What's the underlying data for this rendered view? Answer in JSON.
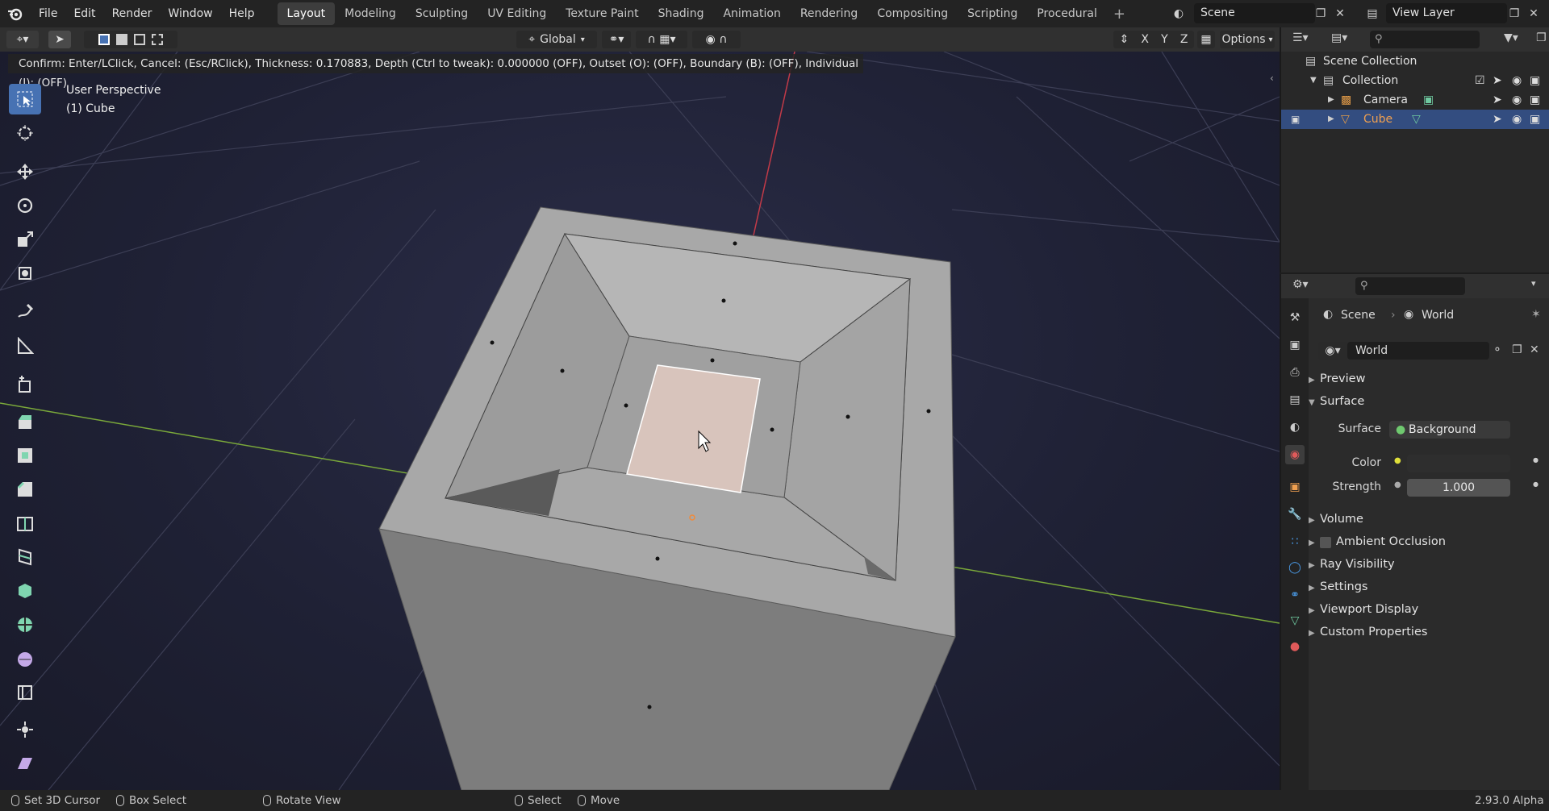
{
  "menu": [
    "File",
    "Edit",
    "Render",
    "Window",
    "Help"
  ],
  "workspaces": [
    "Layout",
    "Modeling",
    "Sculpting",
    "UV Editing",
    "Texture Paint",
    "Shading",
    "Animation",
    "Rendering",
    "Compositing",
    "Scripting",
    "Procedural"
  ],
  "active_workspace": "Layout",
  "scene_name": "Scene",
  "view_layer": "View Layer",
  "viewport_header": {
    "transform_orientation": "Global",
    "axes": [
      "X",
      "Y",
      "Z"
    ],
    "options_label": "Options"
  },
  "operator_status": "Confirm: Enter/LClick, Cancel: (Esc/RClick), Thickness: 0.170883, Depth (Ctrl to tweak): 0.000000 (OFF), Outset (O): (OFF), Boundary (B): (OFF), Individual (I): (OFF)",
  "viewport": {
    "view_name": "User Perspective",
    "object_info": "(1) Cube"
  },
  "outliner": {
    "root": "Scene Collection",
    "items": [
      {
        "label": "Collection",
        "selected": false
      },
      {
        "label": "Camera",
        "selected": false
      },
      {
        "label": "Cube",
        "selected": true
      }
    ]
  },
  "properties": {
    "breadcrumb": [
      "Scene",
      "World"
    ],
    "world_name": "World",
    "sections": [
      "Preview",
      "Surface",
      "Volume",
      "Ambient Occlusion",
      "Ray Visibility",
      "Settings",
      "Viewport Display",
      "Custom Properties"
    ],
    "surface_label": "Surface",
    "surface_value": "Background",
    "color_label": "Color",
    "strength_label": "Strength",
    "strength_value": "1.000"
  },
  "statusbar": {
    "items": [
      "Set 3D Cursor",
      "Box Select",
      "Rotate View",
      "Select",
      "Move"
    ],
    "version": "2.93.0 Alpha"
  },
  "colors": {
    "accent": "#4772b3",
    "selected_row": "#334d80",
    "face_selected": "#d8c4bc",
    "grid_red": "#c23a48",
    "grid_green": "#7aa83a"
  }
}
